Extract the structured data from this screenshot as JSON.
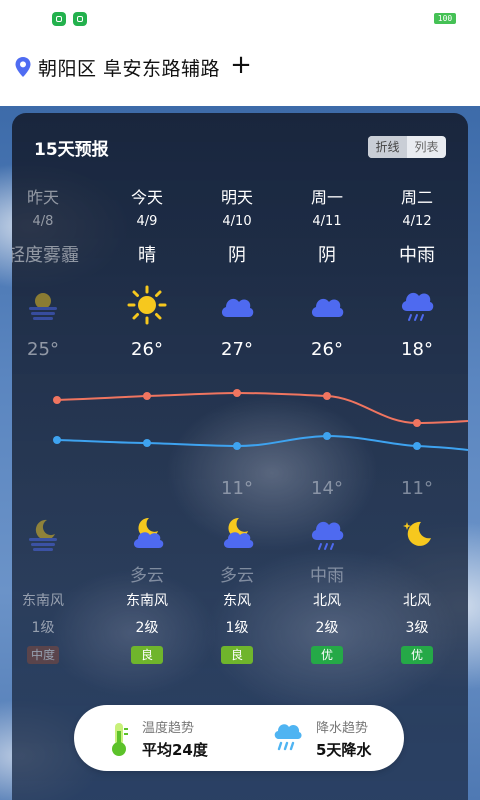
{
  "status_bar": {
    "battery": "100",
    "colors": {
      "badge": "#23b14d"
    }
  },
  "header": {
    "location": "朝阳区 阜安东路辅路",
    "add_symbol": "+"
  },
  "forecast": {
    "title": "15天预报",
    "toggle": {
      "line": "折线",
      "list": "列表",
      "selected": "折线"
    },
    "days": [
      {
        "day": "昨天",
        "date": "4/8",
        "condition": "轻度雾霾",
        "icon": "haze-sun-icon",
        "high": "25°",
        "night_icon": "haze-moon-icon",
        "wind_dir": "东南风",
        "wind_level": "1级",
        "aqi": "中度",
        "aqi_color": "#8a4a3a",
        "past": true
      },
      {
        "day": "今天",
        "date": "4/9",
        "condition": "晴",
        "icon": "sun-icon",
        "high": "26°",
        "night_icon": "cloudy-moon-icon",
        "night_condition": "多云",
        "wind_dir": "东南风",
        "wind_level": "2级",
        "aqi": "良",
        "aqi_color": "#6fb52c",
        "past": false
      },
      {
        "day": "明天",
        "date": "4/10",
        "condition": "阴",
        "icon": "cloud-icon",
        "high": "27°",
        "low": "11°",
        "night_icon": "cloudy-moon-icon",
        "night_condition": "多云",
        "wind_dir": "东风",
        "wind_level": "1级",
        "aqi": "良",
        "aqi_color": "#6fb52c",
        "past": false
      },
      {
        "day": "周一",
        "date": "4/11",
        "condition": "阴",
        "icon": "cloud-icon",
        "high": "26°",
        "low": "14°",
        "night_icon": "rain-cloud-icon",
        "night_condition": "中雨",
        "wind_dir": "北风",
        "wind_level": "2级",
        "aqi": "优",
        "aqi_color": "#25a947",
        "past": false
      },
      {
        "day": "周二",
        "date": "4/12",
        "condition": "中雨",
        "icon": "rain-cloud-icon",
        "high": "18°",
        "low": "11°",
        "night_icon": "clear-moon-icon",
        "wind_dir": "北风",
        "wind_level": "3级",
        "aqi": "优",
        "aqi_color": "#25a947",
        "past": false
      }
    ]
  },
  "trend": {
    "temp_title": "温度趋势",
    "temp_value": "平均24度",
    "rain_title": "降水趋势",
    "rain_value": "5天降水"
  },
  "colors": {
    "high_line": "#f07560",
    "low_line": "#3ea3f0",
    "icon_blue": "#4e6af0",
    "sun": "#f6c81e"
  }
}
